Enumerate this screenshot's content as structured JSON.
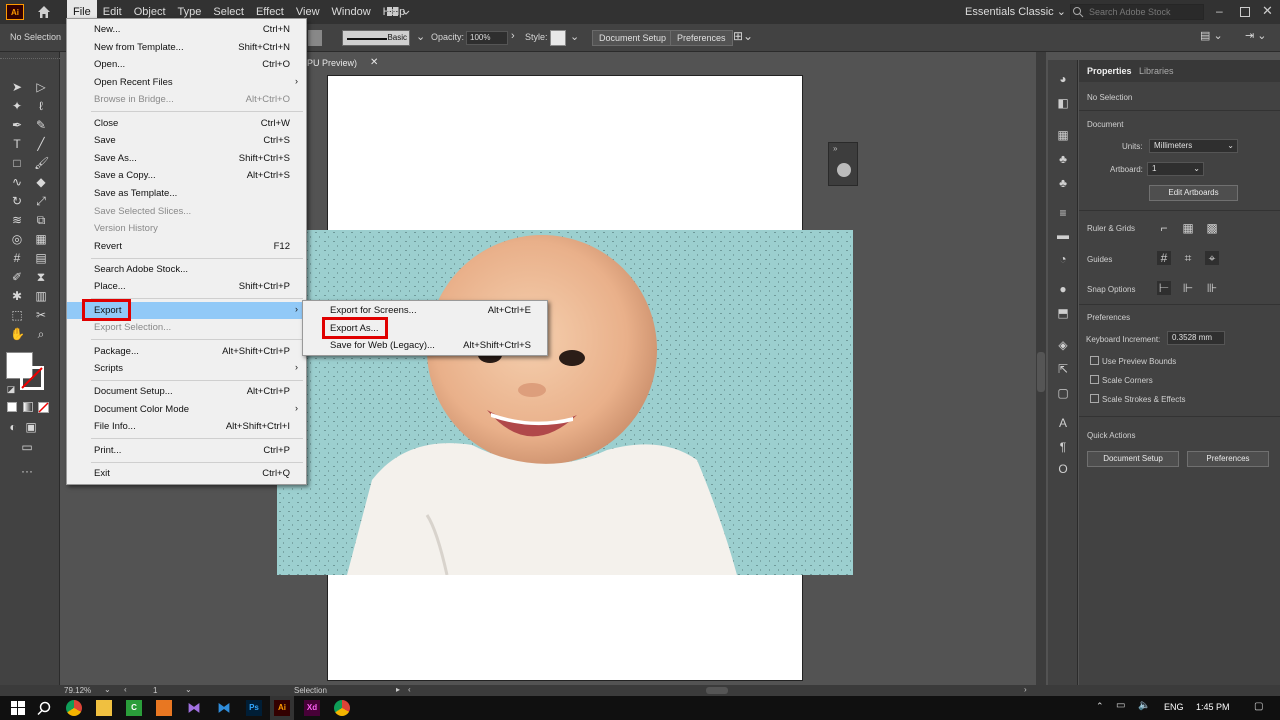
{
  "menubar": {
    "logo": "Ai",
    "items": [
      "File",
      "Edit",
      "Object",
      "Type",
      "Select",
      "Effect",
      "View",
      "Window",
      "Help"
    ],
    "active_index": 0,
    "workspace": "Essentials Classic",
    "search_placeholder": "Search Adobe Stock"
  },
  "controlbar": {
    "selection": "No Selection",
    "stroke_style": "Basic",
    "opacity_label": "Opacity:",
    "opacity_value": "100%",
    "style_label": "Style:",
    "document_setup": "Document Setup",
    "preferences": "Preferences"
  },
  "document": {
    "tab_title": "PU Preview)"
  },
  "file_menu": {
    "items": [
      {
        "label": "New...",
        "shortcut": "Ctrl+N"
      },
      {
        "label": "New from Template...",
        "shortcut": "Shift+Ctrl+N"
      },
      {
        "label": "Open...",
        "shortcut": "Ctrl+O"
      },
      {
        "label": "Open Recent Files",
        "shortcut": ""
      },
      {
        "label": "Browse in Bridge...",
        "shortcut": "Alt+Ctrl+O"
      },
      {
        "label": "Close",
        "shortcut": "Ctrl+W"
      },
      {
        "label": "Save",
        "shortcut": "Ctrl+S"
      },
      {
        "label": "Save As...",
        "shortcut": "Shift+Ctrl+S"
      },
      {
        "label": "Save a Copy...",
        "shortcut": "Alt+Ctrl+S"
      },
      {
        "label": "Save as Template...",
        "shortcut": ""
      },
      {
        "label": "Save Selected Slices...",
        "shortcut": ""
      },
      {
        "label": "Version History",
        "shortcut": ""
      },
      {
        "label": "Revert",
        "shortcut": "F12"
      },
      {
        "label": "Search Adobe Stock...",
        "shortcut": ""
      },
      {
        "label": "Place...",
        "shortcut": "Shift+Ctrl+P"
      },
      {
        "label": "Export",
        "shortcut": ""
      },
      {
        "label": "Export Selection...",
        "shortcut": ""
      },
      {
        "label": "Package...",
        "shortcut": "Alt+Shift+Ctrl+P"
      },
      {
        "label": "Scripts",
        "shortcut": ""
      },
      {
        "label": "Document Setup...",
        "shortcut": "Alt+Ctrl+P"
      },
      {
        "label": "Document Color Mode",
        "shortcut": ""
      },
      {
        "label": "File Info...",
        "shortcut": "Alt+Shift+Ctrl+I"
      },
      {
        "label": "Print...",
        "shortcut": "Ctrl+P"
      },
      {
        "label": "Exit",
        "shortcut": "Ctrl+Q"
      }
    ]
  },
  "export_submenu": {
    "items": [
      {
        "label": "Export for Screens...",
        "shortcut": "Alt+Ctrl+E"
      },
      {
        "label": "Export As...",
        "shortcut": ""
      },
      {
        "label": "Save for Web (Legacy)...",
        "shortcut": "Alt+Shift+Ctrl+S"
      }
    ]
  },
  "properties": {
    "tab_properties": "Properties",
    "tab_libraries": "Libraries",
    "no_selection": "No Selection",
    "document_heading": "Document",
    "units_label": "Units:",
    "units_value": "Millimeters",
    "artboard_label": "Artboard:",
    "artboard_value": "1",
    "edit_artboards": "Edit Artboards",
    "rulers_grids": "Ruler & Grids",
    "guides": "Guides",
    "snap_options": "Snap Options",
    "preferences_heading": "Preferences",
    "keyboard_increment_label": "Keyboard Increment:",
    "keyboard_increment_value": "0.3528 mm",
    "use_preview_bounds": "Use Preview Bounds",
    "scale_corners": "Scale Corners",
    "scale_strokes": "Scale Strokes & Effects",
    "quick_actions": "Quick Actions",
    "document_setup_btn": "Document Setup",
    "preferences_btn": "Preferences"
  },
  "statusbar": {
    "zoom": "79.12%",
    "artboard": "1",
    "tool": "Selection"
  },
  "taskbar": {
    "language": "ENG",
    "time": "1:45 PM"
  },
  "colors": {
    "highlight_blue": "#91c9f7",
    "annotation_red": "#e00000",
    "photo_bg": "#9ccfcf"
  }
}
